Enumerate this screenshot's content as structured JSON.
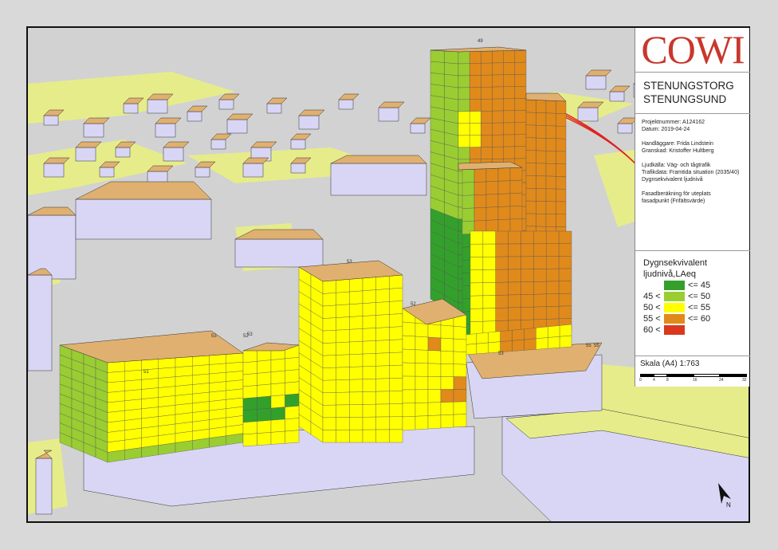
{
  "company": "COWI",
  "project": {
    "title_line1": "STENUNGSTORG",
    "title_line2": "STENUNGSUND",
    "number": "Projektnummer: A124162",
    "date": "Datum: 2019-04-24",
    "handler": "Handläggare: Frida Lindstein",
    "reviewer": "Granskad: Kristoffer Hultberg",
    "source": "Ljudkälla: Väg- och tågtrafik",
    "traffic": "Trafikdata: Framtida situation (2035/40)",
    "measure": "Dygnsekvivalent ljudnivå",
    "method1": "Fasadberäkning för uteplats",
    "method2": "fasadpunkt (Frifältsvärde)"
  },
  "legend": {
    "title_line1": "Dygnsekvivalent",
    "title_line2": "ljudnivå,LAeq",
    "classes": [
      {
        "lower": "",
        "upper": "<= 45",
        "color": "#33a02c"
      },
      {
        "lower": "45 <",
        "upper": "<= 50",
        "color": "#9acd32"
      },
      {
        "lower": "50 <",
        "upper": "<= 55",
        "color": "#ffff00"
      },
      {
        "lower": "55 <",
        "upper": "<= 60",
        "color": "#e08a1c"
      },
      {
        "lower": "60 <",
        "upper": "",
        "color": "#d9381e"
      }
    ]
  },
  "scale": {
    "label": "Skala (A4) 1:763",
    "ticks": [
      "0",
      "4",
      "8",
      "16",
      "24",
      "32"
    ]
  },
  "north_symbol": "north-arrow",
  "colors": {
    "roof": "#e0b070",
    "wall": "#d8d6f4",
    "ground": "#d2d2d2",
    "grass": "#e6ec8a",
    "cell_border": "#555555",
    "rail": "#e02020"
  },
  "point_labels": [
    "49",
    "53",
    "52",
    "52",
    "53",
    "53",
    "55",
    "55",
    "53",
    "51"
  ]
}
